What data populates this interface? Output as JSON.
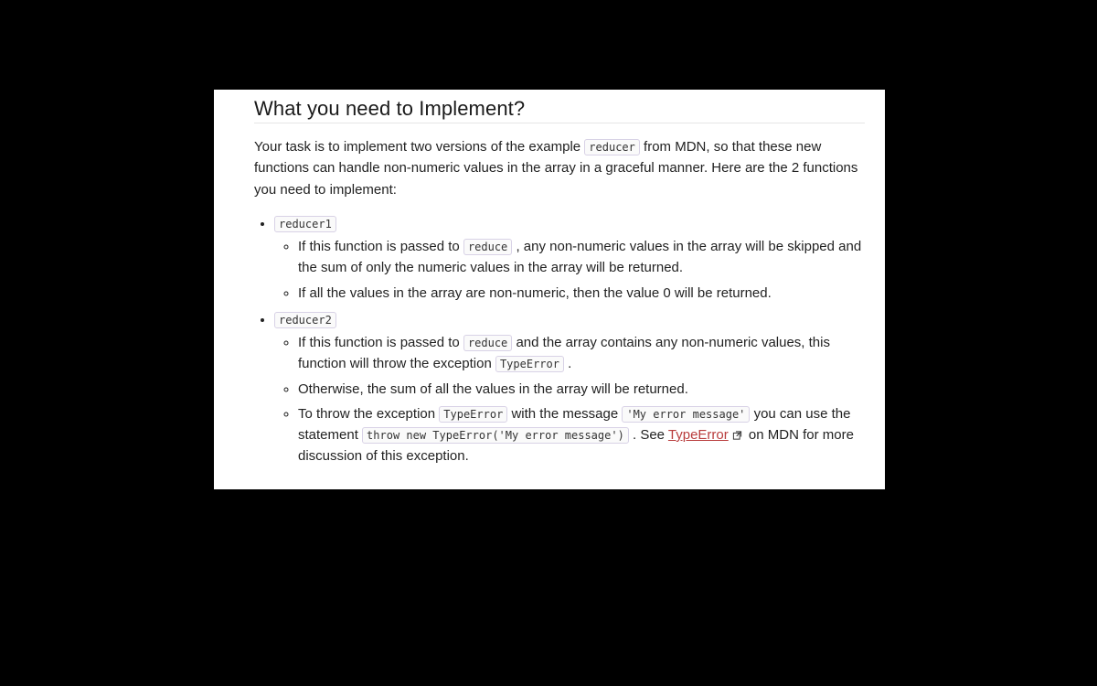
{
  "heading": "What you need to Implement?",
  "intro": {
    "t1": "Your task is to implement two versions of the example ",
    "c1": "reducer",
    "t2": " from MDN, so that these new functions can handle non-numeric values in the array in a graceful manner. Here are the 2 functions you need to implement:"
  },
  "items": [
    {
      "name": "reducer1",
      "subs": [
        {
          "parts": [
            {
              "text": "If this function is passed to "
            },
            {
              "code": "reduce"
            },
            {
              "text": " , any non-numeric values in the array will be skipped and the sum of only the numeric values in the array will be returned."
            }
          ]
        },
        {
          "parts": [
            {
              "text": "If all the values in the array are non-numeric, then the value 0 will be returned."
            }
          ]
        }
      ]
    },
    {
      "name": "reducer2",
      "subs": [
        {
          "parts": [
            {
              "text": "If this function is passed to "
            },
            {
              "code": "reduce"
            },
            {
              "text": " and the array contains any non-numeric values, this function will throw the exception "
            },
            {
              "code": "TypeError"
            },
            {
              "text": " ."
            }
          ]
        },
        {
          "parts": [
            {
              "text": "Otherwise, the sum of all the values in the array will be returned."
            }
          ]
        },
        {
          "parts": [
            {
              "text": "To throw the exception "
            },
            {
              "code": "TypeError"
            },
            {
              "text": " with the message "
            },
            {
              "code": "'My error message'"
            },
            {
              "text": "  you can use the statement "
            },
            {
              "code": "throw new TypeError('My error message')"
            },
            {
              "text": " . See "
            },
            {
              "link": "TypeError"
            },
            {
              "ext_icon": true
            },
            {
              "text": " on MDN for more discussion of this exception."
            }
          ]
        }
      ]
    }
  ],
  "link_text": "TypeError"
}
